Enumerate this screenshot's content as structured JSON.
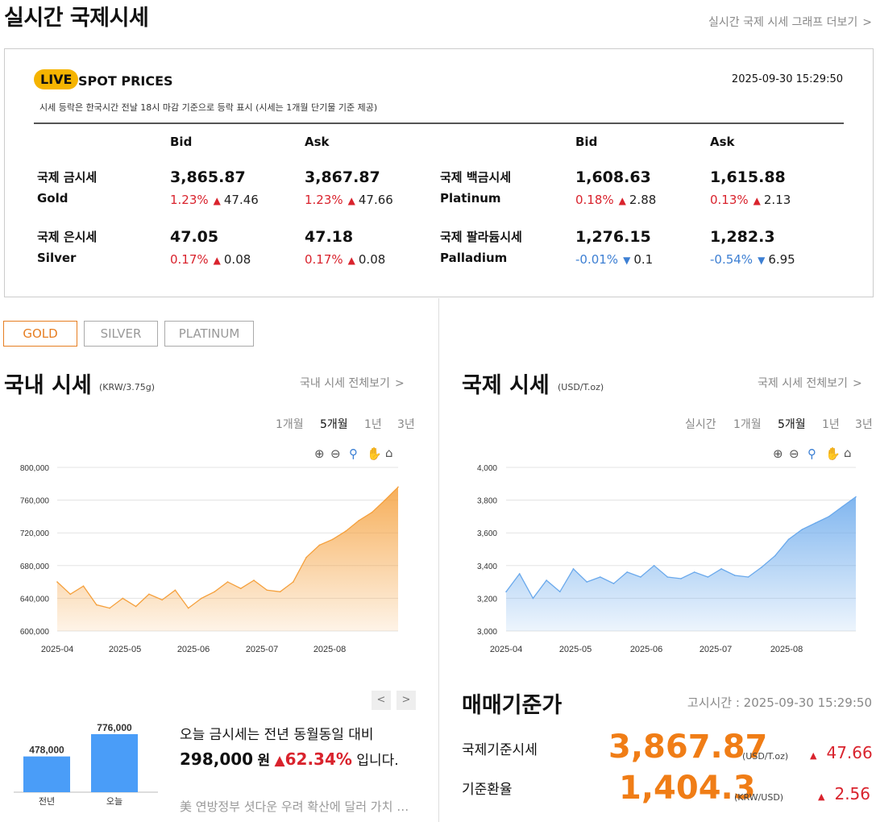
{
  "page": {
    "title": "실시간 국제시세",
    "graph_link": "실시간 국제 시세 그래프 더보기"
  },
  "spot": {
    "live": "LIVE",
    "title": "SPOT PRICES",
    "timestamp": "2025-09-30 15:29:50",
    "notice": "시세 등락은 한국시간 전날 18시 마감 기준으로 등락 표시 (시세는 1개월 단기물 기준 제공)",
    "bid_label": "Bid",
    "ask_label": "Ask",
    "metals": [
      {
        "ko": "국제 금시세",
        "en": "Gold",
        "bid": "3,865.87",
        "bid_pct": "1.23%",
        "bid_amt": "47.46",
        "bid_dir": "up",
        "ask": "3,867.87",
        "ask_pct": "1.23%",
        "ask_amt": "47.66",
        "ask_dir": "up"
      },
      {
        "ko": "국제 은시세",
        "en": "Silver",
        "bid": "47.05",
        "bid_pct": "0.17%",
        "bid_amt": "0.08",
        "bid_dir": "up",
        "ask": "47.18",
        "ask_pct": "0.17%",
        "ask_amt": "0.08",
        "ask_dir": "up"
      },
      {
        "ko": "국제 백금시세",
        "en": "Platinum",
        "bid": "1,608.63",
        "bid_pct": "0.18%",
        "bid_amt": "2.88",
        "bid_dir": "up",
        "ask": "1,615.88",
        "ask_pct": "0.13%",
        "ask_amt": "2.13",
        "ask_dir": "up"
      },
      {
        "ko": "국제 팔라듐시세",
        "en": "Palladium",
        "bid": "1,276.15",
        "bid_pct": "-0.01%",
        "bid_amt": "0.1",
        "bid_dir": "down",
        "ask": "1,282.3",
        "ask_pct": "-0.54%",
        "ask_amt": "6.95",
        "ask_dir": "down"
      }
    ],
    "up_color": "#d9232d",
    "down_color": "#3d7fd3"
  },
  "tabs": [
    "GOLD",
    "SILVER",
    "PLATINUM"
  ],
  "active_tab": "GOLD",
  "domestic": {
    "title": "국내 시세",
    "unit": "(KRW/3.75g)",
    "link": "국내 시세 전체보기",
    "periods": [
      "1개월",
      "5개월",
      "1년",
      "3년"
    ],
    "selected_period": "5개월"
  },
  "international": {
    "title": "국제 시세",
    "unit": "(USD/T.oz)",
    "link": "국제 시세 전체보기",
    "periods": [
      "실시간",
      "1개월",
      "5개월",
      "1년",
      "3년"
    ],
    "selected_period": "5개월"
  },
  "chart_icons": [
    "zoom-in-icon",
    "zoom-out-icon",
    "magnify-icon",
    "pan-hand-icon",
    "home-icon"
  ],
  "chart_data": [
    {
      "type": "area",
      "title": "",
      "color": "#f5a03c",
      "x_ticks": [
        "2025-04",
        "2025-05",
        "2025-06",
        "2025-07",
        "2025-08"
      ],
      "y_ticks": [
        "600,000",
        "640,000",
        "680,000",
        "720,000",
        "760,000",
        "800,000"
      ],
      "ylim": [
        600000,
        800000
      ],
      "grid": true,
      "x": [
        "2025-04-01",
        "2025-04-08",
        "2025-04-15",
        "2025-04-22",
        "2025-04-29",
        "2025-05-06",
        "2025-05-13",
        "2025-05-20",
        "2025-05-27",
        "2025-06-03",
        "2025-06-10",
        "2025-06-17",
        "2025-06-24",
        "2025-07-01",
        "2025-07-08",
        "2025-07-15",
        "2025-07-22",
        "2025-07-29",
        "2025-08-05",
        "2025-08-12",
        "2025-08-19",
        "2025-08-26",
        "2025-09-02",
        "2025-09-09",
        "2025-09-16",
        "2025-09-23",
        "2025-09-30"
      ],
      "values": [
        660000,
        645000,
        655000,
        632000,
        628000,
        640000,
        630000,
        645000,
        638000,
        650000,
        628000,
        640000,
        648000,
        660000,
        652000,
        662000,
        650000,
        648000,
        660000,
        690000,
        705000,
        712000,
        722000,
        735000,
        745000,
        760000,
        776000
      ]
    },
    {
      "type": "area",
      "title": "",
      "color": "#6aa9ec",
      "x_ticks": [
        "2025-04",
        "2025-05",
        "2025-06",
        "2025-07",
        "2025-08"
      ],
      "y_ticks": [
        "3,000",
        "3,200",
        "3,400",
        "3,600",
        "3,800",
        "4,000"
      ],
      "ylim": [
        3000,
        4000
      ],
      "grid": true,
      "x": [
        "2025-04-01",
        "2025-04-08",
        "2025-04-15",
        "2025-04-22",
        "2025-04-29",
        "2025-05-06",
        "2025-05-13",
        "2025-05-20",
        "2025-05-27",
        "2025-06-03",
        "2025-06-10",
        "2025-06-17",
        "2025-06-24",
        "2025-07-01",
        "2025-07-08",
        "2025-07-15",
        "2025-07-22",
        "2025-07-29",
        "2025-08-05",
        "2025-08-12",
        "2025-08-19",
        "2025-08-26",
        "2025-09-02",
        "2025-09-09",
        "2025-09-16",
        "2025-09-23",
        "2025-09-30"
      ],
      "values": [
        3240,
        3350,
        3200,
        3310,
        3240,
        3380,
        3300,
        3330,
        3290,
        3360,
        3330,
        3400,
        3330,
        3320,
        3360,
        3330,
        3380,
        3340,
        3330,
        3390,
        3460,
        3560,
        3620,
        3660,
        3700,
        3760,
        3820
      ]
    },
    {
      "type": "bar",
      "title": "",
      "categories": [
        "전년",
        "오늘"
      ],
      "values": [
        478000,
        776000
      ],
      "value_labels": [
        "478,000",
        "776,000"
      ],
      "color": "#4a9df8"
    }
  ],
  "today": {
    "line1": "오늘 금시세는 전년 동월동일 대비",
    "amount": "298,000",
    "won": "원",
    "pct": "62.34%",
    "suffix": "입니다.",
    "news": "美 연방정부 셧다운 우려 확산에 달러 가치 하락"
  },
  "reference": {
    "title": "매매기준가",
    "notice_time": "고시시간 : 2025-09-30 15:29:50",
    "rows": [
      {
        "label": "국제기준시세",
        "value": "3,867.87",
        "unit": "(USD/T.oz)",
        "change": "47.66"
      },
      {
        "label": "기준환율",
        "value": "1,404.3",
        "unit": "(KRW/USD)",
        "change": "2.56"
      }
    ]
  }
}
